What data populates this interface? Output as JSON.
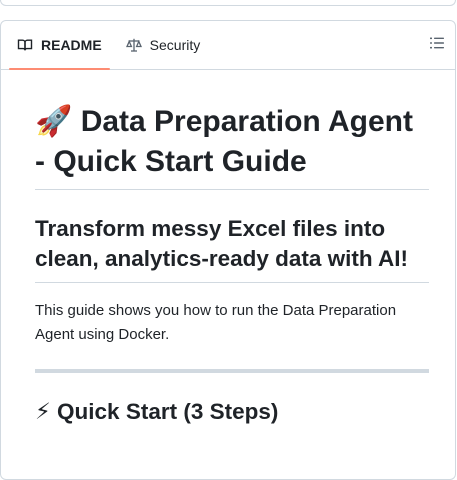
{
  "tabs": [
    {
      "label": "README",
      "icon": "book-icon",
      "active": true
    },
    {
      "label": "Security",
      "icon": "scale-icon",
      "active": false
    }
  ],
  "outline_icon": "list-icon",
  "readme": {
    "title": "🚀 Data Preparation Agent - Quick Start Guide",
    "subtitle": "Transform messy Excel files into clean, analytics-ready data with AI!",
    "intro": "This guide shows you how to run the Data Preparation Agent using Docker.",
    "section_heading": "⚡ Quick Start (3 Steps)"
  },
  "colors": {
    "active_tab_underline": "#fd8c73",
    "border": "#d1d9e0",
    "text": "#1f2328",
    "muted_icon": "#59636e"
  }
}
